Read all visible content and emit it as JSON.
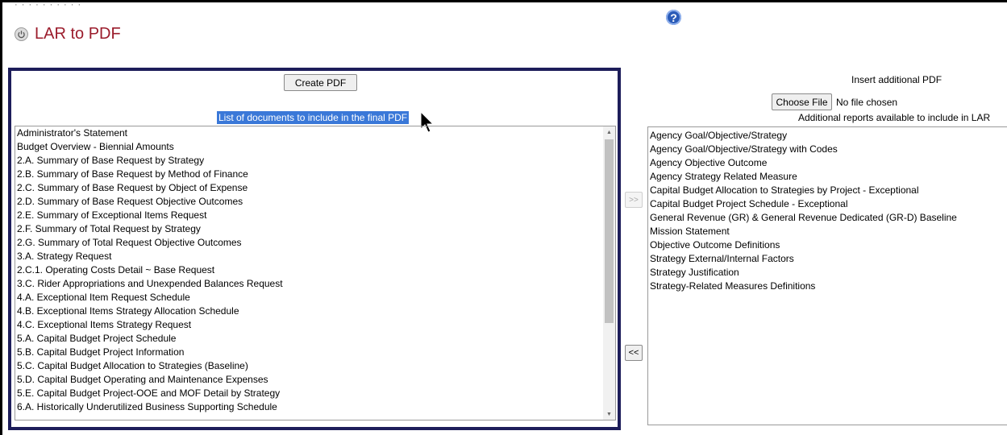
{
  "header": {
    "top_cut_text": "· · · · · · · · · ·",
    "title": "LAR to PDF",
    "power_icon": "power-icon",
    "help_icon": "help-icon",
    "help_glyph": "?"
  },
  "left_panel": {
    "create_button": "Create PDF",
    "list_caption": "List of documents to include in the final PDF",
    "documents": [
      "Administrator's Statement",
      "Budget Overview - Biennial Amounts",
      "2.A. Summary of Base Request by Strategy",
      "2.B. Summary of Base Request by Method of Finance",
      "2.C. Summary of Base Request by Object of Expense",
      "2.D. Summary of Base Request Objective Outcomes",
      "2.E. Summary of Exceptional Items Request",
      "2.F. Summary of Total Request by Strategy",
      "2.G. Summary of Total Request Objective Outcomes",
      "3.A. Strategy Request",
      "2.C.1. Operating Costs Detail ~ Base Request",
      "3.C. Rider Appropriations and Unexpended Balances Request",
      "4.A. Exceptional Item Request Schedule",
      "4.B. Exceptional Items Strategy Allocation Schedule",
      "4.C. Exceptional Items Strategy Request",
      "5.A. Capital Budget Project Schedule",
      "5.B. Capital Budget Project Information",
      "5.C. Capital Budget Allocation to Strategies (Baseline)",
      "5.D. Capital Budget Operating and Maintenance Expenses",
      "5.E. Capital Budget Project-OOE and MOF Detail by Strategy",
      "6.A. Historically Underutilized Business Supporting Schedule"
    ]
  },
  "transfer": {
    "move_right_label": ">>",
    "move_left_label": "<<"
  },
  "right_panel": {
    "insert_title": "Insert additional PDF",
    "choose_file_label": "Choose File",
    "no_file_text": "No file chosen",
    "additional_caption": "Additional reports available to include in LAR",
    "reports": [
      "Agency Goal/Objective/Strategy",
      "Agency Goal/Objective/Strategy with Codes",
      "Agency Objective Outcome",
      "Agency Strategy Related Measure",
      "Capital Budget Allocation to Strategies by Project - Exceptional",
      "Capital Budget Project Schedule - Exceptional",
      "General Revenue (GR) & General Revenue Dedicated (GR-D) Baseline",
      "Mission Statement",
      "Objective Outcome Definitions",
      "Strategy External/Internal Factors",
      "Strategy Justification",
      "Strategy-Related Measures Definitions"
    ]
  },
  "colors": {
    "title": "#9b1c2c",
    "panel_border": "#1d1d5a",
    "selection": "#3a78d8",
    "help": "#2a5bb8"
  }
}
